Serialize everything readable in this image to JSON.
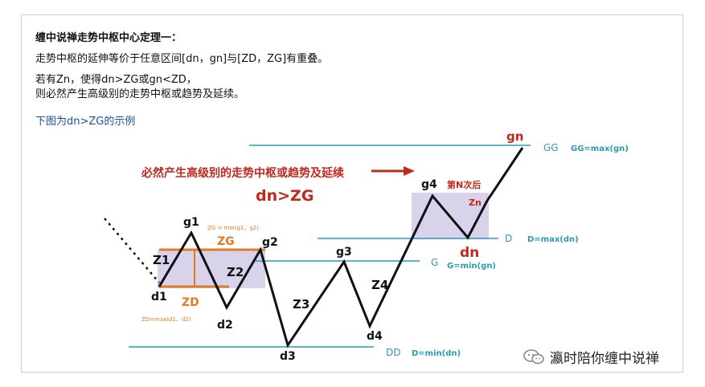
{
  "header": {
    "title": "缠中说禅走势中枢中心定理一：",
    "line1": "走势中枢的延伸等价于任意区间[dn，gn]与[ZD，ZG]有重叠。",
    "line2": "若有Zn，使得dn>ZG或gn<ZD，",
    "line3": "则必然产生高级别的走势中枢或趋势及延续。",
    "example_caption": "下图为dn>ZG的示例"
  },
  "diagram": {
    "headline": "必然产生高级别的走势中枢或趋势及延续",
    "condition": "dn>ZG",
    "nth_time": "第N次后",
    "points": {
      "gn": "gn",
      "g4": "g4",
      "g1": "g1",
      "g2": "g2",
      "g3": "g3",
      "d1": "d1",
      "d2": "d2",
      "d3": "d3",
      "d4": "d4",
      "dn": "dn"
    },
    "segments": {
      "z1": "Z1",
      "z2": "Z2",
      "z3": "Z3",
      "z4": "Z4",
      "zn": "Zn"
    },
    "zone": {
      "zg_label": "ZG",
      "zd_label": "ZD",
      "zg_formula": "ZG = min(g1，g2)",
      "zd_formula": "ZD=max(d1、d2)"
    },
    "levels": {
      "gg_label": "GG",
      "gg_formula": "GG=max(gn)",
      "d_label": "D",
      "d_formula": "D=max(dn)",
      "g_label": "G",
      "g_formula": "G=min(gn)",
      "dd_label": "DD",
      "dd_formula": "D=min(dn)"
    },
    "colors": {
      "accent_red": "#c0281e",
      "orange": "#e07b22",
      "teal": "#2e98b8",
      "box": "#d8d3ea"
    }
  },
  "watermark": {
    "text": "瀛时陪你缠中说禅",
    "icon": "wechat-icon"
  }
}
